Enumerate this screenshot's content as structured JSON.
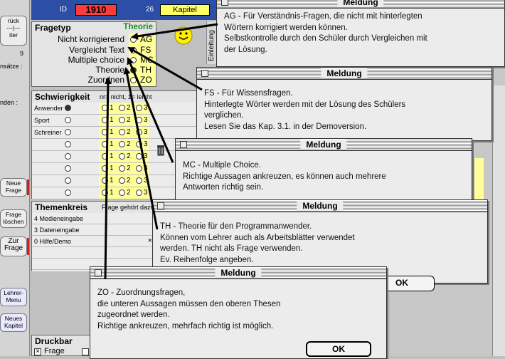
{
  "left": {
    "top_pill": "rück\n---|---\niter",
    "number_9": "9",
    "label_ansaetze": "nsätze :",
    "label_enden": "nden :",
    "buttons": {
      "neue_frage": "Neue\nFrage",
      "frage_loeschen": "Frage\nlöschen",
      "zur_frage": "Zur\nFrage",
      "lehrer_menu": "Lehrer-\nMenu",
      "neues_kapitel": "Neues\nKapitel"
    }
  },
  "header": {
    "id_label": "ID",
    "id_value": "1910",
    "kapitel_num": "26",
    "kapitel_label": "Kapitel"
  },
  "fragetyp": {
    "title": "Fragetyp",
    "selected_label": "Theorie",
    "rows": [
      {
        "label": "Nicht korrigierend",
        "code": "AG"
      },
      {
        "label": "Vergleicht Text",
        "code": "FS"
      },
      {
        "label": "Multiple choice",
        "code": "MC"
      },
      {
        "label": "Theorie",
        "code": "TH"
      },
      {
        "label": "Zuordnen",
        "code": "ZO"
      }
    ],
    "einleitung": "Einleitung"
  },
  "schwierigkeit": {
    "title": "Schwierigkeit",
    "hint": "nr= nicht, 1= leicht",
    "rows": [
      "Anwender",
      "Sport",
      "Schreiner",
      "",
      "",
      "",
      "",
      ""
    ],
    "levels": [
      "1",
      "2",
      "3"
    ]
  },
  "themenkreis": {
    "title": "Themenkreis",
    "hint": "Frage gehört dazu",
    "rows": [
      "4 Medieneingabe",
      "3 Dateneingabe",
      "0 Hilfe/Demo",
      "",
      ""
    ],
    "checkmark": "×"
  },
  "druckbar": {
    "title": "Druckbar",
    "option": "Frage"
  },
  "dialogs": {
    "title": "Meldung",
    "ok": "OK",
    "ag": "AG - Für Verständnis-Fragen, die nicht mit hinterlegten\nWörtern korrigiert werden können.\nSelbstkontrolle durch den Schüler durch Vergleichen mit\nder Lösung.",
    "fs": "FS - Für Wissensfragen.\nHinterlegte Wörter werden mit der Lösung des Schülers\nverglichen.\nLesen Sie das Kap. 3.1. in der Demoversion.",
    "mc": "MC - Multiple Choice.\nRichtige Aussagen ankreuzen, es können auch mehrere\nAntworten richtig sein.",
    "th": "TH - Theorie für den Programmanwender.\nKönnen vom Lehrer auch als Arbeitsblätter verwendet\nwerden. TH nicht als Frage verwenden.\nEv. Reihenfolge angeben.",
    "zo": "ZO - Zuordnungsfragen,\ndie unteren Aussagen müssen den oberen Thesen\nzugeordnet werden.\nRichtige ankreuzen, mehrfach richtig ist möglich."
  }
}
